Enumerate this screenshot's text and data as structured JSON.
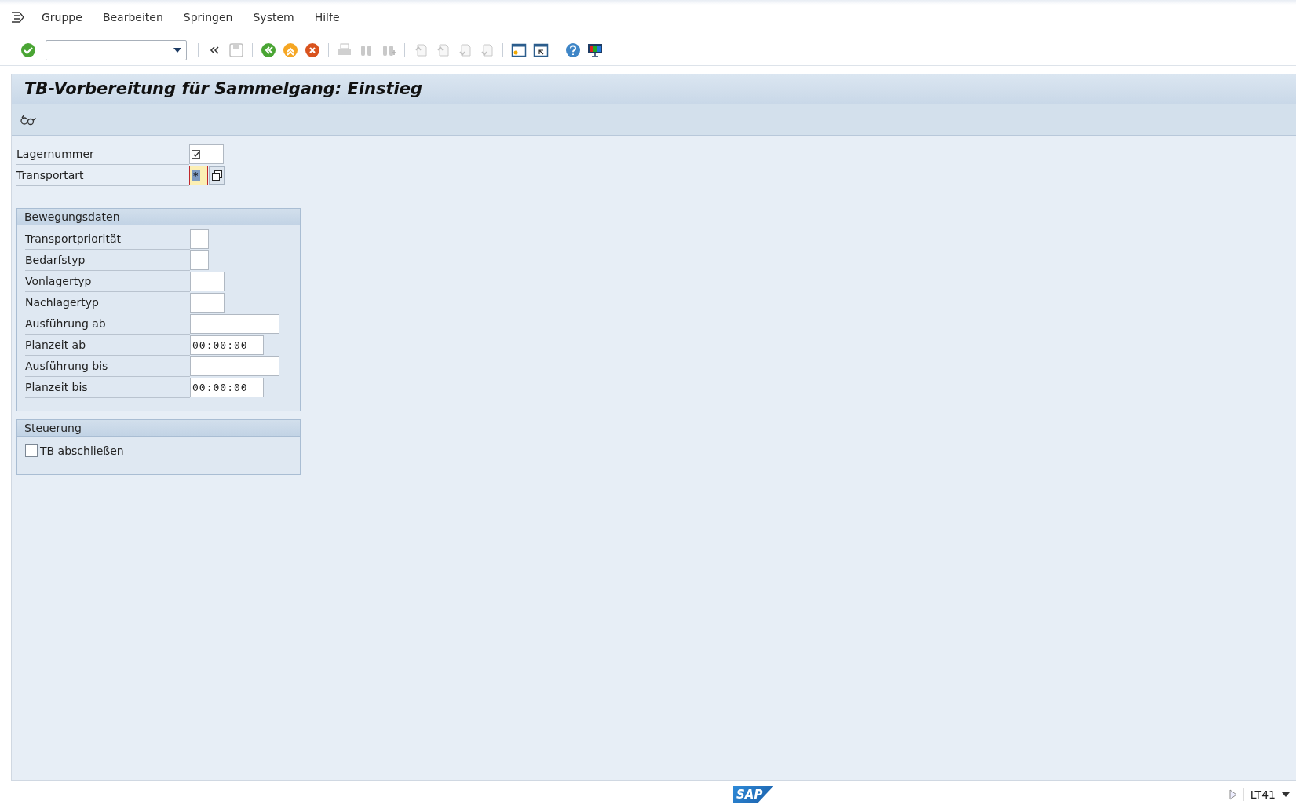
{
  "menu": [
    "Gruppe",
    "Bearbeiten",
    "Springen",
    "System",
    "Hilfe"
  ],
  "toolbar": {
    "buttons": [
      {
        "kind": "enter",
        "disabled": false
      },
      {
        "kind": "sep"
      },
      {
        "kind": "collapse",
        "disabled": false
      },
      {
        "kind": "save",
        "disabled": true
      },
      {
        "kind": "sep"
      },
      {
        "kind": "back",
        "disabled": false
      },
      {
        "kind": "exit",
        "disabled": false
      },
      {
        "kind": "cancel",
        "disabled": false
      },
      {
        "kind": "sep"
      },
      {
        "kind": "print",
        "disabled": true
      },
      {
        "kind": "find",
        "disabled": true
      },
      {
        "kind": "findnext",
        "disabled": true
      },
      {
        "kind": "sep"
      },
      {
        "kind": "first",
        "disabled": true
      },
      {
        "kind": "prev",
        "disabled": true
      },
      {
        "kind": "next",
        "disabled": true
      },
      {
        "kind": "last",
        "disabled": true
      },
      {
        "kind": "sep"
      },
      {
        "kind": "newsession",
        "disabled": false
      },
      {
        "kind": "shortcut",
        "disabled": false
      },
      {
        "kind": "sep"
      },
      {
        "kind": "help",
        "disabled": false
      },
      {
        "kind": "layout",
        "disabled": false
      }
    ]
  },
  "title": "TB-Vorbereitung für Sammelgang: Einstieg",
  "header_fields": [
    {
      "label": "Lagernummer",
      "kind": "required",
      "focused": false
    },
    {
      "label": "Transportart",
      "kind": "multi",
      "value": "*",
      "focused": true
    }
  ],
  "groups": [
    {
      "title": "Bewegungsdaten",
      "fields": [
        {
          "label": "Transportpriorität",
          "kind": "text"
        },
        {
          "label": "Bedarfstyp",
          "kind": "text"
        },
        {
          "label": "Vonlagertyp",
          "kind": "text"
        },
        {
          "label": "Nachlagertyp",
          "kind": "text"
        },
        {
          "label": "Ausführung ab",
          "kind": "text"
        },
        {
          "label": "Planzeit ab",
          "kind": "text",
          "value": "00:00:00"
        },
        {
          "label": "Ausführung bis",
          "kind": "text"
        },
        {
          "label": "Planzeit bis",
          "kind": "text",
          "value": "00:00:00"
        }
      ]
    },
    {
      "title": "Steuerung",
      "checkboxes": [
        {
          "label": "TB abschließen",
          "checked": false
        }
      ]
    }
  ],
  "status_bar": {
    "logo": "SAP",
    "transaction": "LT41"
  }
}
